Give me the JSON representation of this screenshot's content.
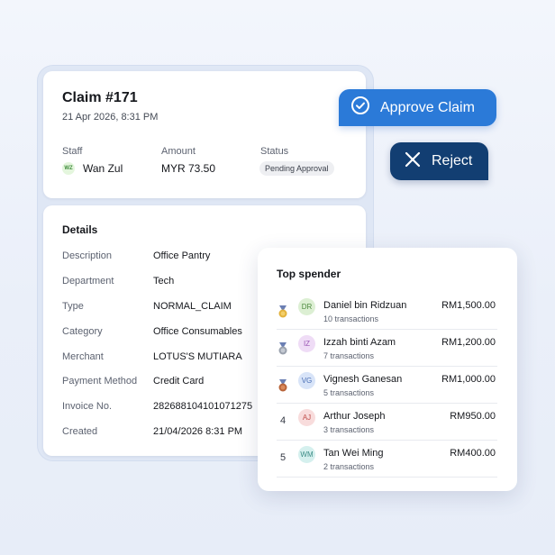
{
  "claim": {
    "title": "Claim #171",
    "datetime": "21 Apr 2026, 8:31 PM",
    "staff_label": "Staff",
    "staff_initials": "WZ",
    "staff_name": "Wan Zul",
    "amount_label": "Amount",
    "amount": "MYR 73.50",
    "status_label": "Status",
    "status": "Pending Approval"
  },
  "details": {
    "title": "Details",
    "rows": [
      {
        "label": "Description",
        "value": "Office Pantry"
      },
      {
        "label": "Department",
        "value": "Tech"
      },
      {
        "label": "Type",
        "value": "NORMAL_CLAIM"
      },
      {
        "label": "Category",
        "value": "Office Consumables"
      },
      {
        "label": "Merchant",
        "value": "LOTUS'S MUTIARA"
      },
      {
        "label": "Payment Method",
        "value": "Credit Card"
      },
      {
        "label": "Invoice No.",
        "value": "282688104101071275"
      },
      {
        "label": "Created",
        "value": "21/04/2026 8:31 PM"
      }
    ]
  },
  "actions": {
    "approve_label": "Approve Claim",
    "approve_icon": "check-circle-icon",
    "reject_label": "Reject",
    "reject_icon": "close-icon",
    "approve_color": "#2b7ad8",
    "reject_color": "#123e72"
  },
  "top_spender": {
    "title": "Top spender",
    "items": [
      {
        "rank": "1",
        "icon": "gold-medal-icon",
        "initials": "DR",
        "name": "Daniel bin Ridzuan",
        "transactions": "10 transactions",
        "amount": "RM1,500.00",
        "avatar_bg": "#dcefd3",
        "avatar_fg": "#4d8a3f"
      },
      {
        "rank": "2",
        "icon": "silver-medal-icon",
        "initials": "IZ",
        "name": "Izzah binti Azam",
        "transactions": "7 transactions",
        "amount": "RM1,200.00",
        "avatar_bg": "#efdcf6",
        "avatar_fg": "#9a55b5"
      },
      {
        "rank": "3",
        "icon": "bronze-medal-icon",
        "initials": "VG",
        "name": "Vignesh Ganesan",
        "transactions": "5 transactions",
        "amount": "RM1,000.00",
        "avatar_bg": "#d8e4f8",
        "avatar_fg": "#4a6fb5"
      },
      {
        "rank": "4",
        "icon": "",
        "initials": "AJ",
        "name": "Arthur Joseph",
        "transactions": "3 transactions",
        "amount": "RM950.00",
        "avatar_bg": "#f8dcdc",
        "avatar_fg": "#c0504d"
      },
      {
        "rank": "5",
        "icon": "",
        "initials": "WM",
        "name": "Tan Wei Ming",
        "transactions": "2 transactions",
        "amount": "RM400.00",
        "avatar_bg": "#d5f0ee",
        "avatar_fg": "#3b8c86"
      }
    ]
  }
}
